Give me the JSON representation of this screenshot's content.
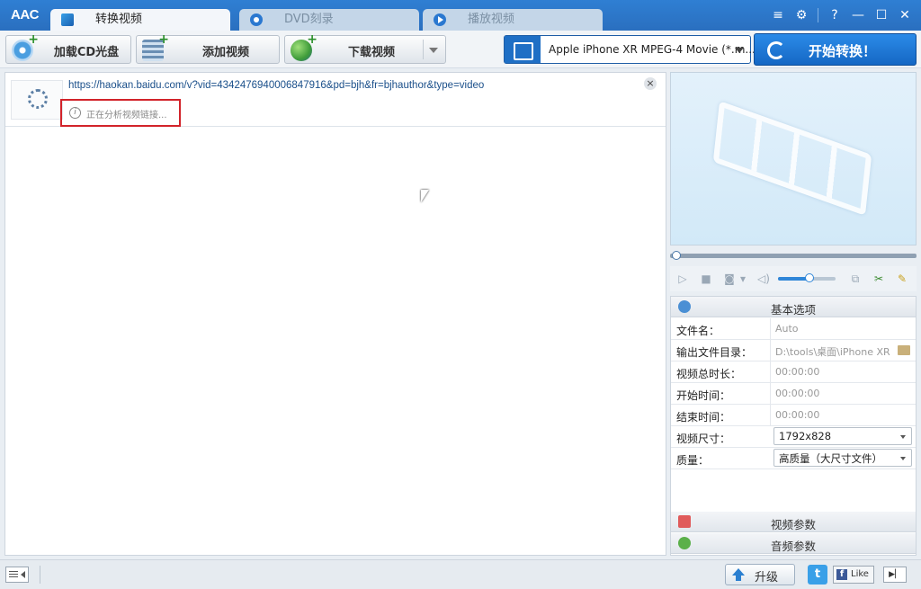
{
  "app": {
    "logo": "AAC"
  },
  "tabs": [
    {
      "label": "转换视频",
      "active": true,
      "icon": "convert-icon"
    },
    {
      "label": "DVD刻录",
      "active": false,
      "icon": "disc-icon"
    },
    {
      "label": "播放视频",
      "active": false,
      "icon": "play-icon"
    }
  ],
  "window_controls": {
    "menu": "≡",
    "settings": "⚙",
    "help": "?",
    "minimize": "—",
    "maximize": "☐",
    "close": "✕"
  },
  "toolbar": {
    "load_cd": "加载CD光盘",
    "add_video": "添加视频",
    "download_video": "下载视频",
    "profile": "Apple iPhone XR MPEG-4 Movie (*.m...",
    "start": "开始转换！"
  },
  "file_list": {
    "items": [
      {
        "url": "https://haokan.baidu.com/v?vid=4342476940006847916&pd=bjh&fr=bjhauthor&type=video",
        "status": "正在分析视频链接..."
      }
    ]
  },
  "player": {
    "seek_progress": 0.0,
    "volume": 0.55
  },
  "settings": {
    "basic_header": "基本选项",
    "rows": [
      {
        "key": "文件名：",
        "value": "Auto"
      },
      {
        "key": "输出文件目录：",
        "value": "D:\\tools\\桌面\\iPhone XR"
      },
      {
        "key": "视频总时长：",
        "value": "00:00:00"
      },
      {
        "key": "开始时间：",
        "value": "00:00:00"
      },
      {
        "key": "结束时间：",
        "value": "00:00:00"
      },
      {
        "key": "视频尺寸：",
        "value": "1792x828"
      },
      {
        "key": "质量：",
        "value": "高质量（大尺寸文件）"
      }
    ],
    "video_params": "视频参数",
    "audio_params": "音频参数"
  },
  "statusbar": {
    "upgrade": "升级",
    "like": "Like",
    "twitter": "t",
    "facebook": "f"
  },
  "colors": {
    "accent": "#2a78d0",
    "highlight": "#d2232a",
    "start_button": "#1f77d6"
  }
}
